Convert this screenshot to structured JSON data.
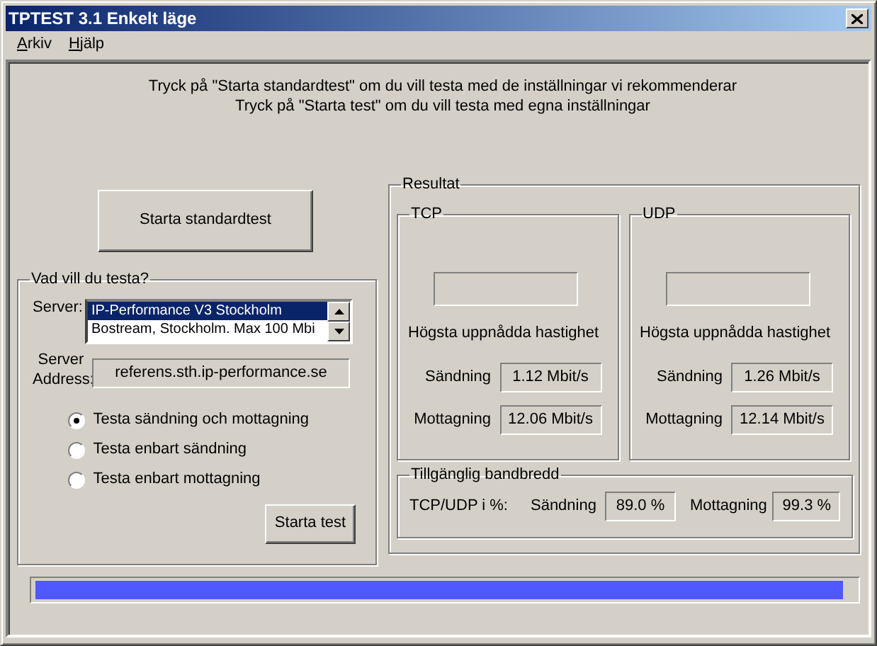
{
  "window": {
    "title": "TPTEST 3.1 Enkelt läge"
  },
  "menu": [
    {
      "label": "Arkiv"
    },
    {
      "label": "Hjälp"
    }
  ],
  "instructions": [
    "Tryck på \"Starta standardtest\" om du vill testa med de inställningar vi rekommenderar",
    "Tryck på \"Starta test\" om du vill testa med egna inställningar"
  ],
  "standard_button": "Starta standardtest",
  "test_options": {
    "legend": "Vad vill du testa?",
    "server_label": "Server:",
    "servers": [
      {
        "name": "IP-Performance V3 Stockholm",
        "selected": true
      },
      {
        "name": "Bostream, Stockholm. Max 100 Mbi",
        "selected": false
      }
    ],
    "server_address_label": "Server Address:",
    "server_address": "referens.sth.ip-performance.se",
    "options": [
      {
        "label": "Testa sändning och mottagning",
        "selected": true
      },
      {
        "label": "Testa enbart sändning",
        "selected": false
      },
      {
        "label": "Testa enbart mottagning",
        "selected": false
      }
    ],
    "start_button": "Starta test"
  },
  "results": {
    "legend": "Resultat",
    "protocols": [
      {
        "name": "TCP",
        "heading": "Högsta uppnådda hastighet",
        "send_label": "Sändning",
        "send_value": "1.12 Mbit/s",
        "receive_label": "Mottagning",
        "receive_value": "12.06 Mbit/s"
      },
      {
        "name": "UDP",
        "heading": "Högsta uppnådda hastighet",
        "send_label": "Sändning",
        "send_value": "1.26 Mbit/s",
        "receive_label": "Mottagning",
        "receive_value": "12.14 Mbit/s"
      }
    ],
    "bandwidth": {
      "legend": "Tillgänglig bandbredd",
      "label": "TCP/UDP i %:",
      "send_label": "Sändning",
      "send_value": "89.0 %",
      "receive_label": "Mottagning",
      "receive_value": "99.3 %"
    }
  },
  "progress": {
    "level": 0.985
  }
}
